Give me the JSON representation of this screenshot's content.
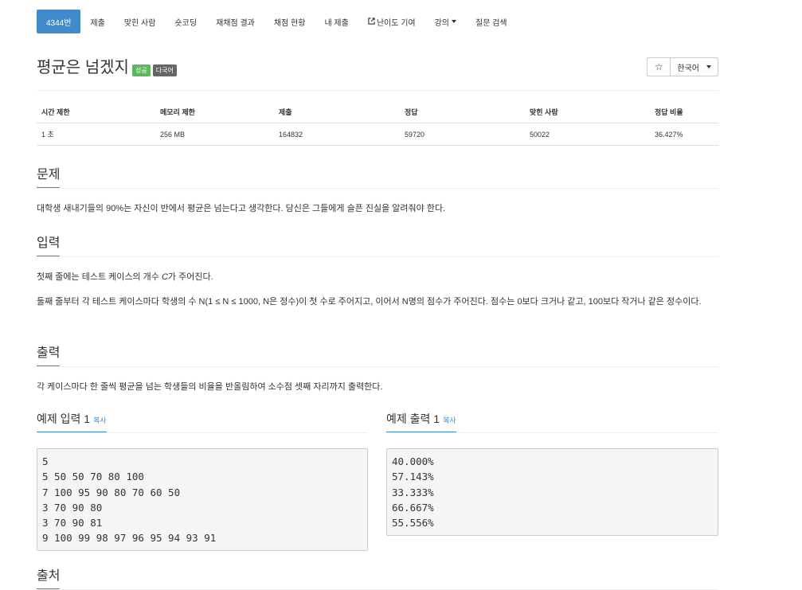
{
  "nav": {
    "items": [
      {
        "label": "4344번",
        "active": true
      },
      {
        "label": "제출"
      },
      {
        "label": "맞힌 사람"
      },
      {
        "label": "숏코딩"
      },
      {
        "label": "재채점 결과"
      },
      {
        "label": "채점 현황"
      },
      {
        "label": "내 제출"
      },
      {
        "label": "난이도 기여",
        "icon": "external-link-icon"
      },
      {
        "label": "강의",
        "dropdown": true
      },
      {
        "label": "질문 검색"
      }
    ]
  },
  "problem": {
    "title": "평균은 넘겠지",
    "badges": {
      "status": "성공",
      "lang": "다국어"
    },
    "star": "☆",
    "language": "한국어"
  },
  "stats": {
    "headers": [
      "시간 제한",
      "메모리 제한",
      "제출",
      "정답",
      "맞힌 사람",
      "정답 비율"
    ],
    "values": [
      "1 초",
      "256 MB",
      "164832",
      "59720",
      "50022",
      "36.427%"
    ]
  },
  "sections": {
    "problem_title": "문제",
    "problem_text": "대학생 새내기들의 90%는 자신이 반에서 평균은 넘는다고 생각한다. 당신은 그들에게 슬픈 진실을 알려줘야 한다.",
    "input_title": "입력",
    "input_text1_a": "첫째 줄에는 테스트 케이스의 개수 ",
    "input_text1_var": "C",
    "input_text1_b": "가 주어진다.",
    "input_text2": "둘째 줄부터 각 테스트 케이스마다 학생의 수 N(1 ≤ N ≤ 1000, N은 정수)이 첫 수로 주어지고, 이어서 N명의 점수가 주어진다. 점수는 0보다 크거나 같고, 100보다 작거나 같은 정수이다.",
    "output_title": "출력",
    "output_text": "각 케이스마다 한 줄씩 평균을 넘는 학생들의 비율을 반올림하여 소수점 셋째 자리까지 출력한다.",
    "source_title": "출처"
  },
  "samples": {
    "input_title": "예제 입력 1",
    "output_title": "예제 출력 1",
    "copy_label": "복사",
    "input": "5\n5 50 50 70 80 100\n7 100 95 90 80 70 60 50\n3 70 90 80\n3 70 90 81\n9 100 99 98 97 96 95 94 93 91",
    "output": "40.000%\n57.143%\n33.333%\n66.667%\n55.556%"
  },
  "colors": {
    "accent": "#428bca",
    "success": "#5cb85c",
    "badge_gray": "#666666"
  }
}
